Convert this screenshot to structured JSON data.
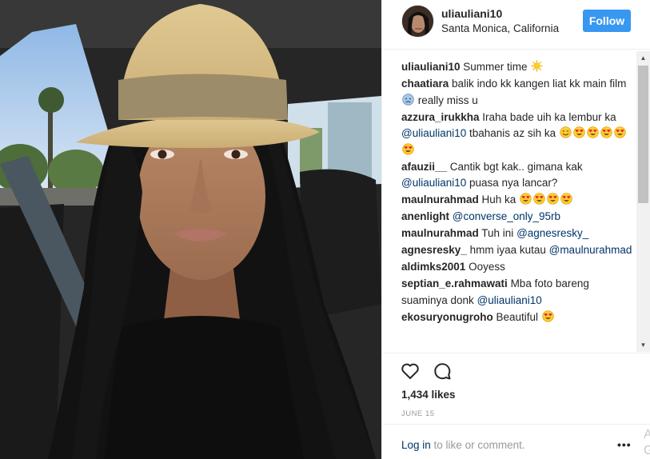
{
  "post": {
    "username": "uliauliani10",
    "location": "Santa Monica, California",
    "follow_label": "Follow"
  },
  "comments": [
    {
      "user": "uliauliani10",
      "parts": [
        {
          "t": " Summer time "
        },
        {
          "e": "sun"
        }
      ]
    },
    {
      "user": "chaatiara",
      "parts": [
        {
          "t": " balik indo kk kangen liat kk main film"
        },
        {
          "e": "sad"
        },
        {
          "t": " really miss u"
        }
      ]
    },
    {
      "user": "azzura_irukkha",
      "parts": [
        {
          "t": " Iraha bade uih ka lembur ka "
        },
        {
          "m": "@uliauliani10"
        },
        {
          "t": " tbahanis az sih ka "
        },
        {
          "e": "smile"
        },
        {
          "e": "hearteyes"
        },
        {
          "e": "hearteyes"
        },
        {
          "e": "hearteyes"
        },
        {
          "e": "hearteyes"
        },
        {
          "e": "hearteyes"
        }
      ]
    },
    {
      "user": "afauzii__",
      "parts": [
        {
          "t": " Cantik bgt kak.. gimana kak "
        },
        {
          "m": "@uliauliani10"
        },
        {
          "t": " puasa nya lancar?"
        }
      ]
    },
    {
      "user": "maulnurahmad",
      "parts": [
        {
          "t": " Huh ka "
        },
        {
          "e": "hearteyes"
        },
        {
          "e": "hearteyes"
        },
        {
          "e": "hearteyes"
        },
        {
          "e": "hearteyes"
        }
      ]
    },
    {
      "user": "anenlight",
      "parts": [
        {
          "t": " "
        },
        {
          "m": "@converse_only_95rb"
        }
      ]
    },
    {
      "user": "maulnurahmad",
      "parts": [
        {
          "t": " Tuh ini "
        },
        {
          "m": "@agnesresky_"
        }
      ]
    },
    {
      "user": "agnesresky_",
      "parts": [
        {
          "t": " hmm iyaa kutau "
        },
        {
          "m": "@maulnurahmad"
        }
      ]
    },
    {
      "user": "aldimks2001",
      "parts": [
        {
          "t": " Ooyess"
        }
      ]
    },
    {
      "user": "septian_e.rahmawati",
      "parts": [
        {
          "t": " Mba foto bareng suaminya donk "
        },
        {
          "m": "@uliauliani10"
        }
      ]
    },
    {
      "user": "ekosuryonugroho",
      "parts": [
        {
          "t": " Beautiful "
        },
        {
          "e": "hearteyes"
        }
      ]
    }
  ],
  "engagement": {
    "likes": "1,434 likes",
    "date": "JUNE 15"
  },
  "footer": {
    "login_link": "Log in",
    "login_rest": " to like or comment.",
    "more": "•••",
    "edge_text": "A\nG"
  },
  "icons": {
    "like": "heart-outline-icon",
    "comment": "speech-bubble-icon",
    "more": "more-options-icon"
  },
  "colors": {
    "follow_bg": "#3897f0",
    "mention": "#003569",
    "muted": "#999999"
  }
}
